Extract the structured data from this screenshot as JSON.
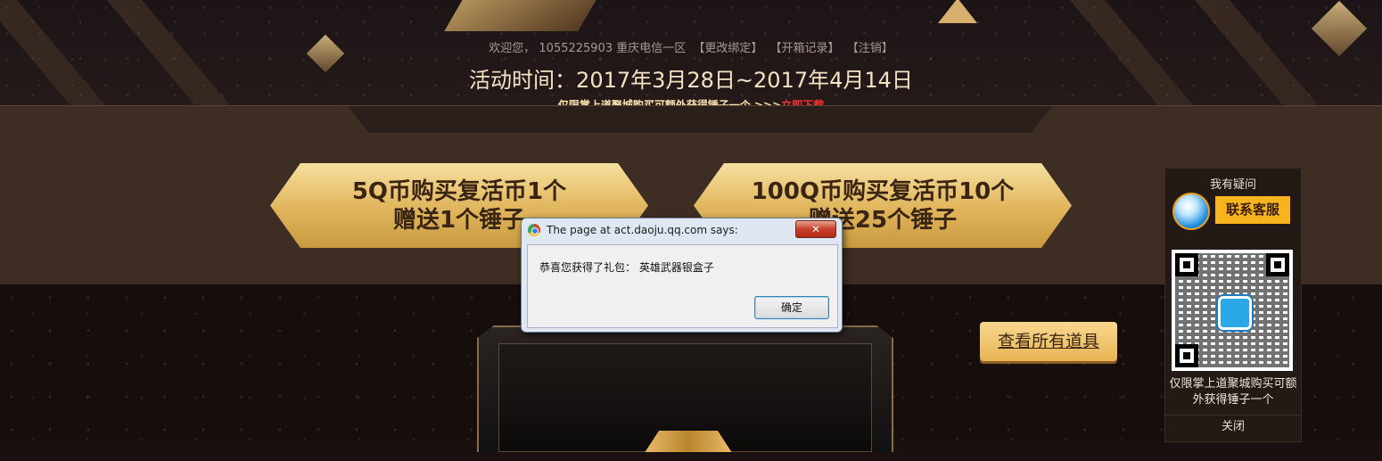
{
  "header": {
    "welcome_text": "欢迎您， 1055225903 重庆电信一区",
    "links": [
      "【更改绑定】",
      "【开箱记录】",
      "【注销】"
    ],
    "activity_time": "活动时间：2017年3月28日~2017年4月14日",
    "promo_text": "仅限掌上道聚城购买可额外获得锤子一个 >>>",
    "promo_link": "立即下载"
  },
  "offers": [
    {
      "line1": "5Q币购买复活币1个",
      "line2": "赠送1个锤子"
    },
    {
      "line1": "100Q币购买复活币10个",
      "line2": "赠送25个锤子"
    }
  ],
  "view_all_label": "查看所有道具",
  "sidebar": {
    "title": "我有疑问",
    "contact_label": "联系客服",
    "text": "仅限掌上道聚城购买可额外获得锤子一个",
    "close_label": "关闭"
  },
  "dialog": {
    "title": "The page at act.daoju.qq.com says:",
    "close_glyph": "✕",
    "message": "恭喜您获得了礼包： 英雄武器银盒子",
    "ok_label": "确定"
  },
  "colors": {
    "accent_gold": "#e2b860",
    "download_link": "#ff3030",
    "contact_button": "#f7b41e"
  }
}
